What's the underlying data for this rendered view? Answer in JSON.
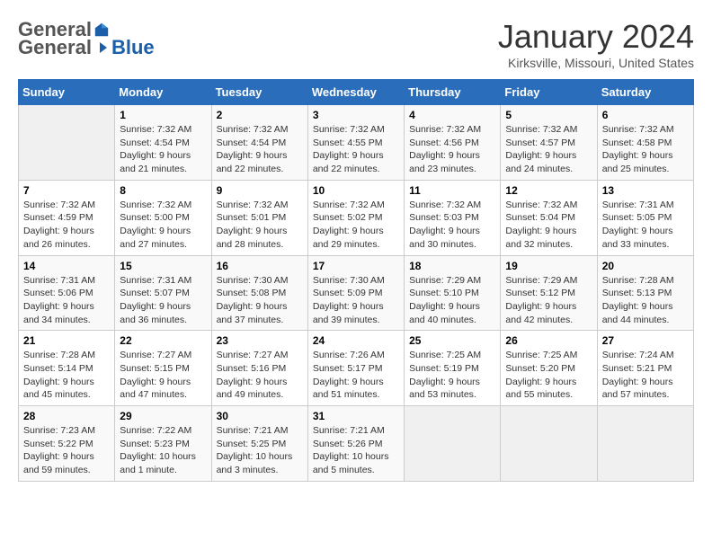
{
  "app": {
    "logo_general": "General",
    "logo_blue": "Blue"
  },
  "header": {
    "title": "January 2024",
    "location": "Kirksville, Missouri, United States"
  },
  "calendar": {
    "days_of_week": [
      "Sunday",
      "Monday",
      "Tuesday",
      "Wednesday",
      "Thursday",
      "Friday",
      "Saturday"
    ],
    "weeks": [
      [
        {
          "day": "",
          "sunrise": "",
          "sunset": "",
          "daylight": ""
        },
        {
          "day": "1",
          "sunrise": "Sunrise: 7:32 AM",
          "sunset": "Sunset: 4:54 PM",
          "daylight": "Daylight: 9 hours and 21 minutes."
        },
        {
          "day": "2",
          "sunrise": "Sunrise: 7:32 AM",
          "sunset": "Sunset: 4:54 PM",
          "daylight": "Daylight: 9 hours and 22 minutes."
        },
        {
          "day": "3",
          "sunrise": "Sunrise: 7:32 AM",
          "sunset": "Sunset: 4:55 PM",
          "daylight": "Daylight: 9 hours and 22 minutes."
        },
        {
          "day": "4",
          "sunrise": "Sunrise: 7:32 AM",
          "sunset": "Sunset: 4:56 PM",
          "daylight": "Daylight: 9 hours and 23 minutes."
        },
        {
          "day": "5",
          "sunrise": "Sunrise: 7:32 AM",
          "sunset": "Sunset: 4:57 PM",
          "daylight": "Daylight: 9 hours and 24 minutes."
        },
        {
          "day": "6",
          "sunrise": "Sunrise: 7:32 AM",
          "sunset": "Sunset: 4:58 PM",
          "daylight": "Daylight: 9 hours and 25 minutes."
        }
      ],
      [
        {
          "day": "7",
          "sunrise": "Sunrise: 7:32 AM",
          "sunset": "Sunset: 4:59 PM",
          "daylight": "Daylight: 9 hours and 26 minutes."
        },
        {
          "day": "8",
          "sunrise": "Sunrise: 7:32 AM",
          "sunset": "Sunset: 5:00 PM",
          "daylight": "Daylight: 9 hours and 27 minutes."
        },
        {
          "day": "9",
          "sunrise": "Sunrise: 7:32 AM",
          "sunset": "Sunset: 5:01 PM",
          "daylight": "Daylight: 9 hours and 28 minutes."
        },
        {
          "day": "10",
          "sunrise": "Sunrise: 7:32 AM",
          "sunset": "Sunset: 5:02 PM",
          "daylight": "Daylight: 9 hours and 29 minutes."
        },
        {
          "day": "11",
          "sunrise": "Sunrise: 7:32 AM",
          "sunset": "Sunset: 5:03 PM",
          "daylight": "Daylight: 9 hours and 30 minutes."
        },
        {
          "day": "12",
          "sunrise": "Sunrise: 7:32 AM",
          "sunset": "Sunset: 5:04 PM",
          "daylight": "Daylight: 9 hours and 32 minutes."
        },
        {
          "day": "13",
          "sunrise": "Sunrise: 7:31 AM",
          "sunset": "Sunset: 5:05 PM",
          "daylight": "Daylight: 9 hours and 33 minutes."
        }
      ],
      [
        {
          "day": "14",
          "sunrise": "Sunrise: 7:31 AM",
          "sunset": "Sunset: 5:06 PM",
          "daylight": "Daylight: 9 hours and 34 minutes."
        },
        {
          "day": "15",
          "sunrise": "Sunrise: 7:31 AM",
          "sunset": "Sunset: 5:07 PM",
          "daylight": "Daylight: 9 hours and 36 minutes."
        },
        {
          "day": "16",
          "sunrise": "Sunrise: 7:30 AM",
          "sunset": "Sunset: 5:08 PM",
          "daylight": "Daylight: 9 hours and 37 minutes."
        },
        {
          "day": "17",
          "sunrise": "Sunrise: 7:30 AM",
          "sunset": "Sunset: 5:09 PM",
          "daylight": "Daylight: 9 hours and 39 minutes."
        },
        {
          "day": "18",
          "sunrise": "Sunrise: 7:29 AM",
          "sunset": "Sunset: 5:10 PM",
          "daylight": "Daylight: 9 hours and 40 minutes."
        },
        {
          "day": "19",
          "sunrise": "Sunrise: 7:29 AM",
          "sunset": "Sunset: 5:12 PM",
          "daylight": "Daylight: 9 hours and 42 minutes."
        },
        {
          "day": "20",
          "sunrise": "Sunrise: 7:28 AM",
          "sunset": "Sunset: 5:13 PM",
          "daylight": "Daylight: 9 hours and 44 minutes."
        }
      ],
      [
        {
          "day": "21",
          "sunrise": "Sunrise: 7:28 AM",
          "sunset": "Sunset: 5:14 PM",
          "daylight": "Daylight: 9 hours and 45 minutes."
        },
        {
          "day": "22",
          "sunrise": "Sunrise: 7:27 AM",
          "sunset": "Sunset: 5:15 PM",
          "daylight": "Daylight: 9 hours and 47 minutes."
        },
        {
          "day": "23",
          "sunrise": "Sunrise: 7:27 AM",
          "sunset": "Sunset: 5:16 PM",
          "daylight": "Daylight: 9 hours and 49 minutes."
        },
        {
          "day": "24",
          "sunrise": "Sunrise: 7:26 AM",
          "sunset": "Sunset: 5:17 PM",
          "daylight": "Daylight: 9 hours and 51 minutes."
        },
        {
          "day": "25",
          "sunrise": "Sunrise: 7:25 AM",
          "sunset": "Sunset: 5:19 PM",
          "daylight": "Daylight: 9 hours and 53 minutes."
        },
        {
          "day": "26",
          "sunrise": "Sunrise: 7:25 AM",
          "sunset": "Sunset: 5:20 PM",
          "daylight": "Daylight: 9 hours and 55 minutes."
        },
        {
          "day": "27",
          "sunrise": "Sunrise: 7:24 AM",
          "sunset": "Sunset: 5:21 PM",
          "daylight": "Daylight: 9 hours and 57 minutes."
        }
      ],
      [
        {
          "day": "28",
          "sunrise": "Sunrise: 7:23 AM",
          "sunset": "Sunset: 5:22 PM",
          "daylight": "Daylight: 9 hours and 59 minutes."
        },
        {
          "day": "29",
          "sunrise": "Sunrise: 7:22 AM",
          "sunset": "Sunset: 5:23 PM",
          "daylight": "Daylight: 10 hours and 1 minute."
        },
        {
          "day": "30",
          "sunrise": "Sunrise: 7:21 AM",
          "sunset": "Sunset: 5:25 PM",
          "daylight": "Daylight: 10 hours and 3 minutes."
        },
        {
          "day": "31",
          "sunrise": "Sunrise: 7:21 AM",
          "sunset": "Sunset: 5:26 PM",
          "daylight": "Daylight: 10 hours and 5 minutes."
        },
        {
          "day": "",
          "sunrise": "",
          "sunset": "",
          "daylight": ""
        },
        {
          "day": "",
          "sunrise": "",
          "sunset": "",
          "daylight": ""
        },
        {
          "day": "",
          "sunrise": "",
          "sunset": "",
          "daylight": ""
        }
      ]
    ]
  }
}
